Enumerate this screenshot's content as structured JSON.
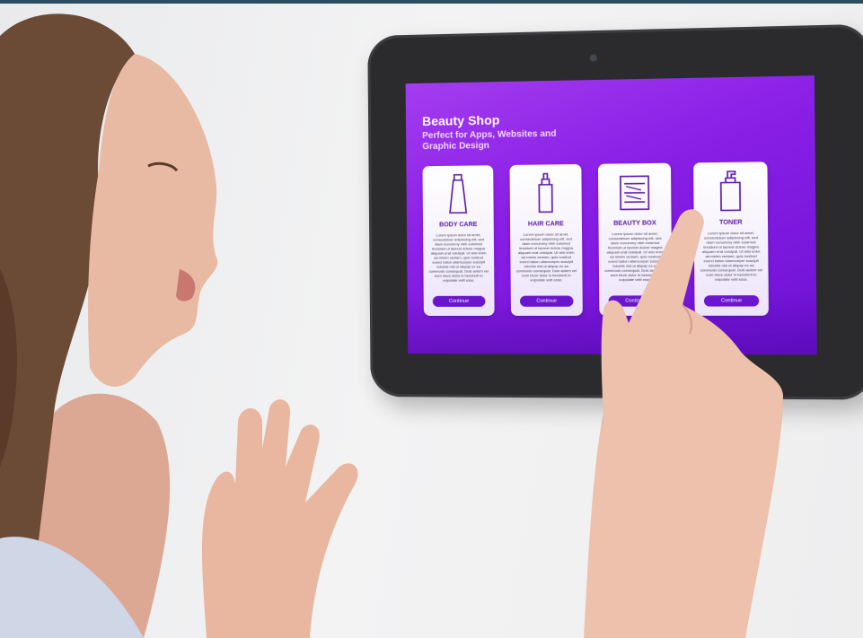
{
  "app": {
    "title": "Beauty Shop",
    "subtitle": "Perfect for Apps, Websites and Graphic Design"
  },
  "cards": [
    {
      "name": "BODY CARE",
      "icon": "lotion-tube-icon",
      "body": "Lorem ipsum dolor sit amet, consectetuer adipiscing elit, sed diam nonummy nibh euismod tincidunt ut laoreet dolore magna aliquam erat volutpat. Ut wisi enim ad minim veniam, quis nostrud exerci tation ullamcorper suscipit lobortis nisl ut aliquip ex ea commodo consequat. Duis autem vel eum iriure dolor in hendrerit in vulputate velit esse.",
      "button": "Continue"
    },
    {
      "name": "HAIR CARE",
      "icon": "spray-bottle-icon",
      "body": "Lorem ipsum dolor sit amet, consectetuer adipiscing elit, sed diam nonummy nibh euismod tincidunt ut laoreet dolore magna aliquam erat volutpat. Ut wisi enim ad minim veniam, quis nostrud exerci tation ullamcorper suscipit lobortis nisl ut aliquip ex ea commodo consequat. Duis autem vel eum iriure dolor in hendrerit in vulputate velit esse.",
      "button": "Continue"
    },
    {
      "name": "BEAUTY BOX",
      "icon": "cosmetics-box-icon",
      "body": "Lorem ipsum dolor sit amet, consectetuer adipiscing elit, sed diam nonummy nibh euismod tincidunt ut laoreet dolore magna aliquam erat volutpat. Ut wisi enim ad minim veniam, quis nostrud exerci tation ullamcorper suscipit lobortis nisl ut aliquip ex ea commodo consequat. Duis autem vel eum iriure dolor in hendrerit in vulputate velit esse.",
      "button": "Continue"
    },
    {
      "name": "TONER",
      "icon": "pump-bottle-icon",
      "body": "Lorem ipsum dolor sit amet, consectetuer adipiscing elit, sed diam nonummy nibh euismod tincidunt ut laoreet dolore magna aliquam erat volutpat. Ut wisi enim ad minim veniam, quis nostrud exerci tation ullamcorper suscipit lobortis nisl ut aliquip ex ea commodo consequat. Duis autem vel eum iriure dolor in hendrerit in vulputate velit esse.",
      "button": "Continue"
    }
  ],
  "colors": {
    "screen_gradient_start": "#a33df0",
    "screen_gradient_end": "#6d11d4",
    "button": "#6a16cf",
    "card_label": "#5a1aa6",
    "tablet_bezel": "#2b2b2e"
  }
}
